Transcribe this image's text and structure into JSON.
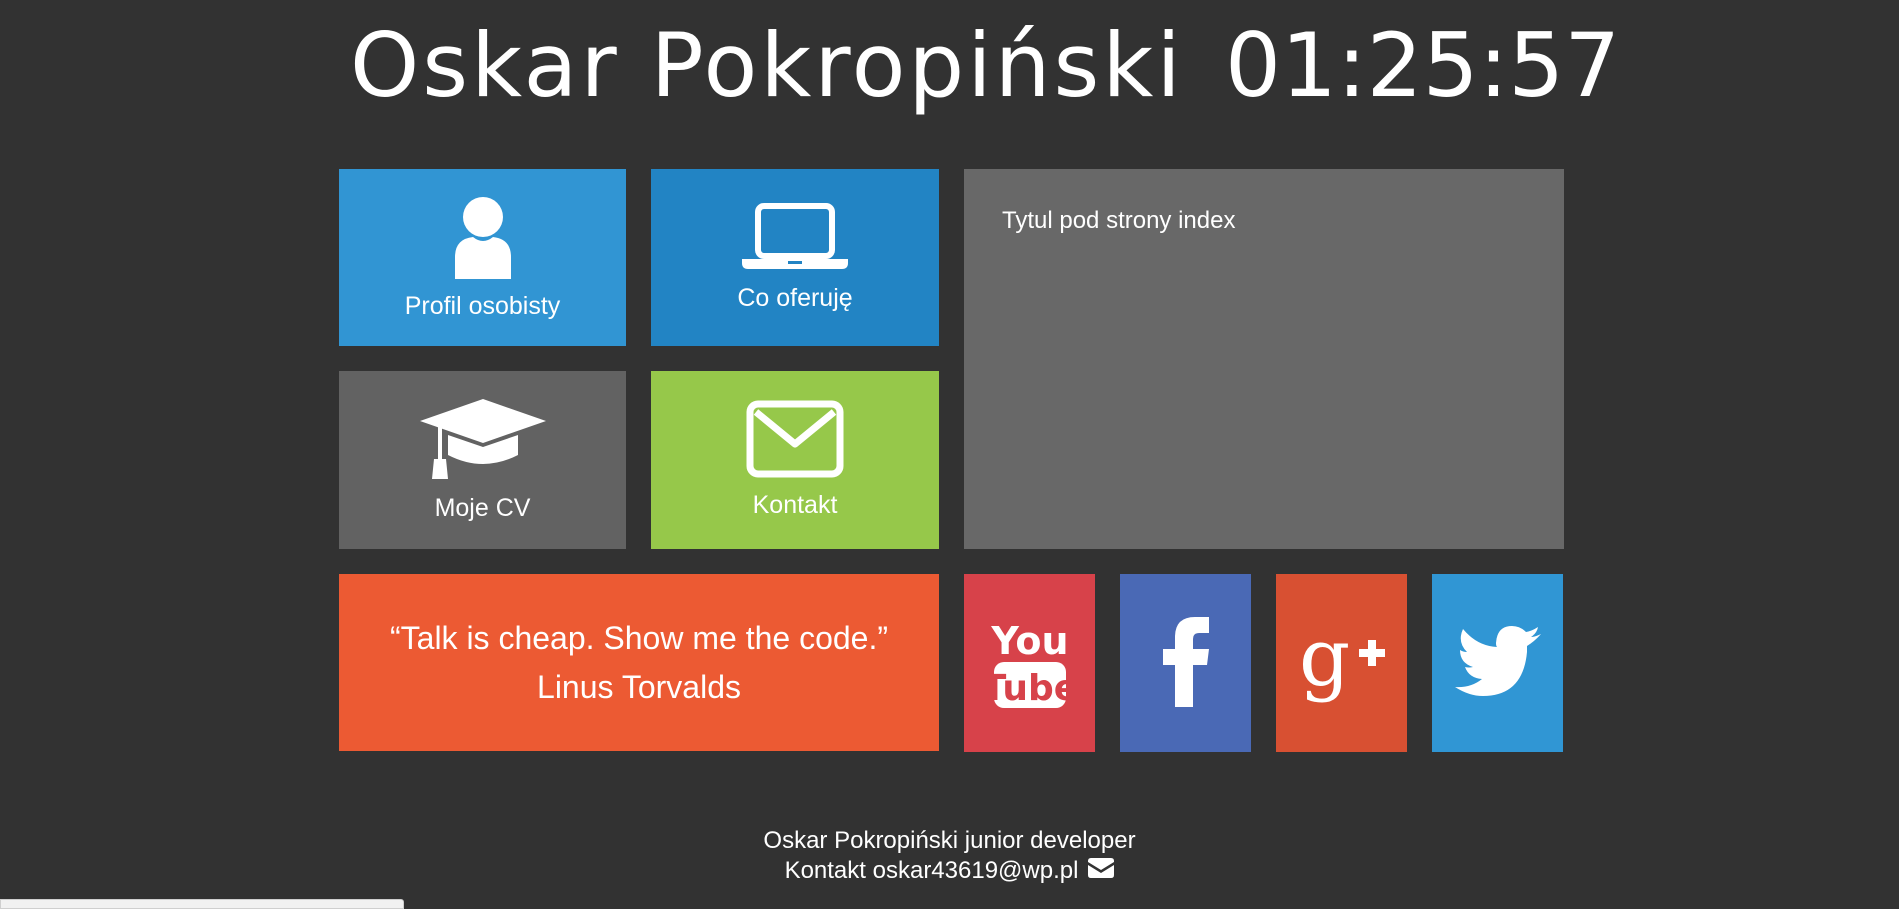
{
  "header": {
    "title": "Oskar Pokropiński",
    "clock": "01:25:57"
  },
  "tiles": [
    {
      "label": "Profil osobisty",
      "icon": "user-icon",
      "color": "#3195d3"
    },
    {
      "label": "Co oferuję",
      "icon": "laptop-icon",
      "color": "#2284c4"
    },
    {
      "label": "Moje CV",
      "icon": "graduation-cap-icon",
      "color": "#626262"
    },
    {
      "label": "Kontakt",
      "icon": "envelope-icon",
      "color": "#96c84a"
    }
  ],
  "panel": {
    "title": "Tytul pod strony index"
  },
  "quote": {
    "text": "“Talk is cheap. Show me the code.”",
    "author": "Linus Torvalds",
    "color": "#ec5a33"
  },
  "social": [
    {
      "icon": "youtube-icon",
      "color": "#d7424a"
    },
    {
      "icon": "facebook-icon",
      "color": "#4a69b5"
    },
    {
      "icon": "google-plus-icon",
      "color": "#d85032"
    },
    {
      "icon": "twitter-icon",
      "color": "#3096d4"
    }
  ],
  "footer": {
    "line1": "Oskar Pokropiński junior developer",
    "line2": "Kontakt oskar43619@wp.pl",
    "icon": "envelope-icon"
  },
  "colors": {
    "background": "#323232",
    "panel": "#686868"
  }
}
